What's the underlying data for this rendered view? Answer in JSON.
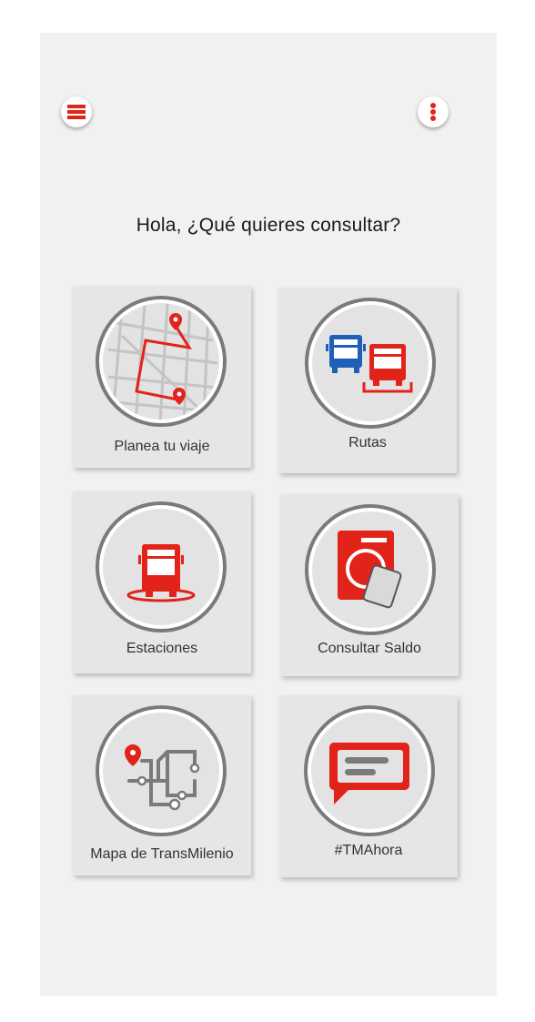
{
  "header": {
    "menu_icon": "hamburger-menu-icon",
    "more_icon": "vertical-dots-icon"
  },
  "greeting": "Hola, ¿Qué quieres consultar?",
  "tiles": [
    {
      "label": "Planea tu viaje",
      "icon": "route-map-icon"
    },
    {
      "label": "Rutas",
      "icon": "buses-icon"
    },
    {
      "label": "Estaciones",
      "icon": "bus-station-icon"
    },
    {
      "label": "Consultar Saldo",
      "icon": "card-recharge-icon"
    },
    {
      "label": "Mapa de TransMilenio",
      "icon": "network-map-icon"
    },
    {
      "label": "#TMAhora",
      "icon": "chat-bubble-icon"
    }
  ],
  "colors": {
    "accent_red": "#e2231a",
    "accent_blue": "#1f5fb8",
    "ring_gray": "#7a7a7a",
    "tile_bg": "#e6e6e6",
    "screen_bg": "#f1f1f1"
  }
}
